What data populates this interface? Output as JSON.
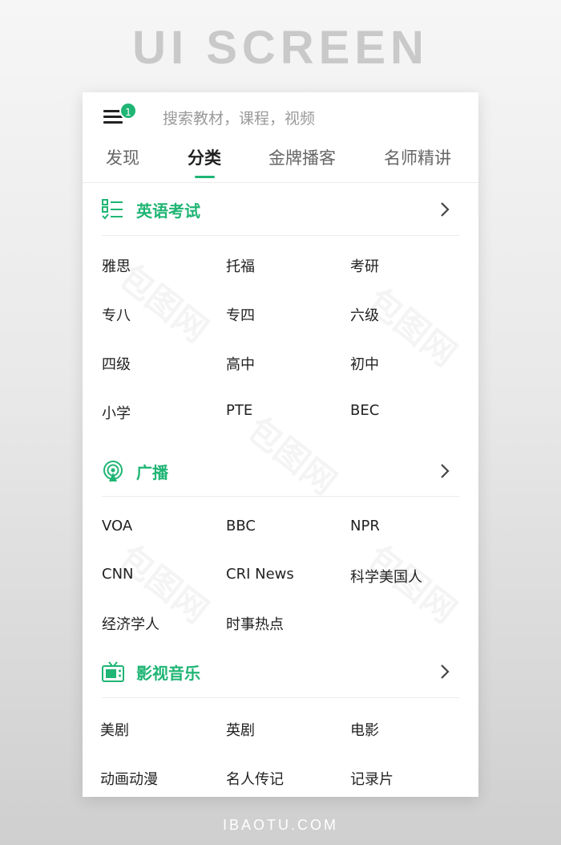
{
  "banner": "UI SCREEN",
  "footer": "IBAOTU.COM",
  "watermark": "包图网",
  "header": {
    "badge_count": "1",
    "search_placeholder": "搜索教材，课程，视频"
  },
  "tabs": [
    {
      "label": "发现"
    },
    {
      "label": "分类",
      "active": true
    },
    {
      "label": "金牌播客"
    },
    {
      "label": "名师精讲"
    }
  ],
  "accent_color": "#1fb574",
  "sections": [
    {
      "title": "英语考试",
      "icon": "checklist-icon",
      "items": [
        "雅思",
        "托福",
        "考研",
        "专八",
        "专四",
        "六级",
        "四级",
        "高中",
        "初中",
        "小学",
        "PTE",
        "BEC"
      ]
    },
    {
      "title": "广播",
      "icon": "broadcast-icon",
      "items": [
        "VOA",
        "BBC",
        "NPR",
        "CNN",
        "CRI News",
        "科学美国人",
        "经济学人",
        "时事热点"
      ]
    },
    {
      "title": "影视音乐",
      "icon": "tv-icon",
      "items": [
        "美剧",
        "英剧",
        "电影",
        "动画动漫",
        "名人传记",
        "记录片"
      ]
    }
  ]
}
